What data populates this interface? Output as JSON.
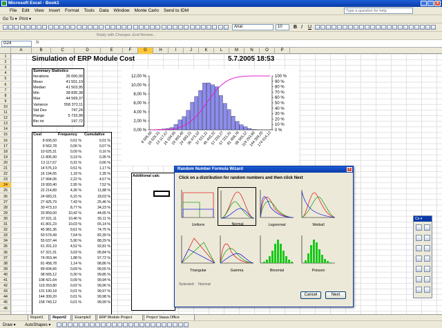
{
  "window": {
    "title": "Microsoft Excel - Book1",
    "min": "_",
    "max": "□",
    "close": "x"
  },
  "menu": {
    "items": [
      "File",
      "Edit",
      "View",
      "Insert",
      "Format",
      "Tools",
      "Data",
      "Window",
      "Monte Carlo",
      "Send to IDM"
    ],
    "help_placeholder": "Type a question for help"
  },
  "toolbar": {
    "goto": "Go To ▾",
    "print": "Print ▾",
    "font_name": "Arial",
    "font_size": "10",
    "reply_changes": "Reply with Changes...",
    "end_review": "End Review...",
    "bold": "B",
    "italic": "I",
    "underline": "U"
  },
  "formula": {
    "cell_ref": "G24",
    "fx": "fx"
  },
  "columns": [
    "A",
    "B",
    "C",
    "D",
    "E",
    "F",
    "G",
    "H",
    "I",
    "J",
    "K",
    "L",
    "M",
    "N",
    "O",
    "P"
  ],
  "rows": [
    "1",
    "2",
    "3",
    "4",
    "5",
    "6",
    "7",
    "8",
    "9",
    "10",
    "11",
    "12",
    "13",
    "14",
    "15",
    "16",
    "17",
    "18",
    "19",
    "20",
    "21",
    "22",
    "23",
    "24",
    "25",
    "26",
    "27",
    "28",
    "29",
    "30",
    "31",
    "32",
    "33",
    "34",
    "35",
    "36",
    "37",
    "38",
    "39",
    "40",
    "41",
    "42",
    "43",
    "44",
    "45",
    "46"
  ],
  "sheet": {
    "title": "Simulation of ERP Module Cost",
    "date": "5.7.2005 18:53",
    "summary_header": "Summary Statistics",
    "summary": [
      {
        "label": "Iterations",
        "value": "35 000,00"
      },
      {
        "label": "Mean",
        "value": "41 501,19"
      },
      {
        "label": "Median",
        "value": "41 503,95"
      },
      {
        "label": "Min",
        "value": "38 835,38"
      },
      {
        "label": "Max",
        "value": "44 569,37"
      },
      {
        "label": "Variance",
        "value": "558 372,11"
      },
      {
        "label": "Std Dev",
        "value": "747,24"
      },
      {
        "label": "Range",
        "value": "5 733,99"
      },
      {
        "label": "Bin int",
        "value": "197,72"
      }
    ],
    "table_headers": [
      "Cost",
      "Frequency",
      "Cumulative"
    ],
    "table": [
      [
        "8 606,50",
        "0,01 %",
        "0,01 %"
      ],
      [
        "9 562,78",
        "0,06 %",
        "0,07 %"
      ],
      [
        "10 625,31",
        "0,09 %",
        "0,16 %"
      ],
      [
        "11 805,90",
        "0,19 %",
        "0,35 %"
      ],
      [
        "13 117,67",
        "0,31 %",
        "0,66 %"
      ],
      [
        "14 575,19",
        "0,51 %",
        "1,17 %"
      ],
      [
        "16 194,65",
        "1,18 %",
        "2,35 %"
      ],
      [
        "17 994,06",
        "2,22 %",
        "4,57 %"
      ],
      [
        "19 993,40",
        "2,95 %",
        "7,52 %"
      ],
      [
        "22 214,89",
        "4,36 %",
        "11,88 %"
      ],
      [
        "24 683,21",
        "6,15 %",
        "18,03 %"
      ],
      [
        "27 425,79",
        "7,43 %",
        "25,46 %"
      ],
      [
        "30 473,10",
        "8,77 %",
        "34,23 %"
      ],
      [
        "33 859,00",
        "10,42 %",
        "44,65 %"
      ],
      [
        "37 621,11",
        "10,46 %",
        "55,11 %"
      ],
      [
        "41 801,23",
        "10,03 %",
        "65,14 %"
      ],
      [
        "45 981,36",
        "9,61 %",
        "74,75 %"
      ],
      [
        "50 579,49",
        "7,64 %",
        "82,39 %"
      ],
      [
        "55 637,44",
        "5,90 %",
        "88,29 %"
      ],
      [
        "61 201,19",
        "4,52 %",
        "92,81 %"
      ],
      [
        "67 321,31",
        "3,03 %",
        "95,84 %"
      ],
      [
        "74 053,44",
        "1,88 %",
        "97,72 %"
      ],
      [
        "81 458,78",
        "1,14 %",
        "98,86 %"
      ],
      [
        "89 604,66",
        "0,69 %",
        "99,55 %"
      ],
      [
        "98 565,12",
        "0,30 %",
        "99,85 %"
      ],
      [
        "108 421,64",
        "0,09 %",
        "99,94 %"
      ],
      [
        "119 263,80",
        "0,02 %",
        "99,96 %"
      ],
      [
        "131 190,18",
        "0,01 %",
        "99,97 %"
      ],
      [
        "144 309,20",
        "0,01 %",
        "99,98 %"
      ],
      [
        "158 740,12",
        "0,01 %",
        "99,99 %"
      ]
    ],
    "additional_label": "Additional calc"
  },
  "chart_data": {
    "type": "bar",
    "title": "",
    "y_left_ticks": [
      "0,00 %",
      "2,00 %",
      "4,00 %",
      "6,00 %",
      "8,00 %",
      "10,00 %",
      "12,00 %"
    ],
    "y_right_ticks": [
      "0 %",
      "10 %",
      "20 %",
      "30 %",
      "40 %",
      "50 %",
      "60 %",
      "70 %",
      "80 %",
      "90 %",
      "100 %"
    ],
    "ylim_left": [
      0,
      12
    ],
    "ylim_right": [
      0,
      100
    ],
    "x_tick_labels": [
      "8 606,50",
      "10 625,31",
      "13 117,67",
      "16 194,65",
      "19 993,40",
      "24 683,21",
      "30 473,10",
      "37 621,11",
      "46 443,32",
      "57 333,27",
      "67 321,31",
      "81 458,78",
      "98 565,12",
      "119 263,80",
      "144 309,20",
      "174 614,13"
    ],
    "frequency": [
      0.01,
      0.06,
      0.09,
      0.19,
      0.31,
      0.51,
      1.18,
      2.22,
      2.95,
      4.36,
      6.15,
      7.43,
      8.77,
      10.42,
      10.46,
      10.03,
      9.61,
      7.64,
      5.9,
      4.52,
      3.03,
      1.88,
      1.14,
      0.69,
      0.3,
      0.09,
      0.02,
      0.01,
      0.01,
      0.01
    ],
    "cumulative": [
      0.01,
      0.07,
      0.16,
      0.35,
      0.66,
      1.17,
      2.35,
      4.57,
      7.52,
      11.88,
      18.03,
      25.46,
      34.23,
      44.65,
      55.11,
      65.14,
      74.75,
      82.39,
      88.29,
      92.81,
      95.84,
      97.72,
      98.86,
      99.55,
      99.85,
      99.94,
      99.96,
      99.97,
      99.98,
      99.99
    ],
    "bar_color": "#8c8cf0",
    "line_color": "#e020c8"
  },
  "dialog": {
    "title": "Random Number Formula Wizard",
    "instruction": "Click on a distribution for random numbers and then click Next",
    "distributions": [
      "Uniform",
      "Normal",
      "Lognormal",
      "Weibull",
      "Triangular",
      "Gamma",
      "Binomial",
      "Poisson"
    ],
    "selected_label": "Selected:",
    "selected_value": "Normal",
    "cancel": "Cancel",
    "next": "Next",
    "close": "x"
  },
  "sheet_tabs": [
    "Report1",
    "Report2",
    "Example2",
    "ERP Module Project",
    "Project Vaasa Office"
  ],
  "active_tab": "Report2",
  "drawbar": {
    "draw": "Draw ▾",
    "autoshapes": "AutoShapes ▾"
  },
  "floating_toolbox": {
    "title": "Ce ▾"
  }
}
